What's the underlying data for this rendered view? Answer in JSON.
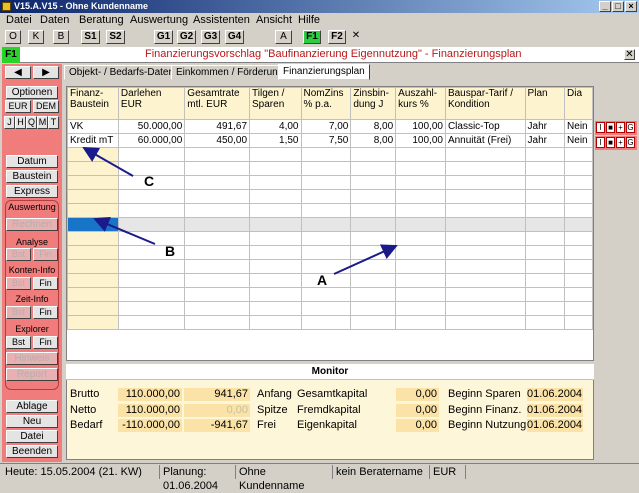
{
  "window": {
    "title": "V15.A.V15 - Ohne Kundenname"
  },
  "menu": [
    "Datei",
    "Daten",
    "Beratung",
    "Auswertung",
    "Assistenten",
    "Ansicht",
    "Hilfe"
  ],
  "toolbar": [
    "O",
    "K",
    "B",
    "S1",
    "S2",
    "G1",
    "G2",
    "G3",
    "G4",
    "A",
    "F1",
    "F2",
    "✕"
  ],
  "header": {
    "badge": "F1",
    "title": "Finanzierungsvorschlag \"Baufinanzierung Eigennutzung\" - Finanzierungsplan"
  },
  "sidebar": {
    "optionen": "Optionen",
    "eur": "EUR",
    "dem": "DEM",
    "period": [
      "J",
      "H",
      "Q",
      "M",
      "T"
    ],
    "datum": "Datum",
    "baustein": "Baustein",
    "express": "Express",
    "auswertung": "Auswertung",
    "rechnen": "Rechnen",
    "analyse": "Analyse",
    "konten": "Konten-Info",
    "zeit": "Zeit-Info",
    "explorer": "Explorer",
    "bst": "Bst",
    "fin": "Fin",
    "hinweis": "Hinweis",
    "report": "Report",
    "ablage": "Ablage",
    "neu": "Neu",
    "datei": "Datei",
    "beenden": "Beenden"
  },
  "tabs": [
    "Objekt- / Bedarfs-Daten",
    "Einkommen / Förderung",
    "Finanzierungsplan"
  ],
  "grid": {
    "headers": [
      "Finanz-Baustein",
      "Darlehen EUR",
      "Gesamtrate mtl. EUR",
      "Tilgen / Sparen",
      "NomZins % p.a.",
      "Zinsbin-dung J",
      "Auszahl-kurs %",
      "Bauspar-Tarif / Kondition",
      "Plan",
      "Dia"
    ],
    "rows": [
      [
        "VK",
        "50.000,00",
        "491,67",
        "4,00",
        "7,00",
        "8,00",
        "100,00",
        "Classic-Top",
        "Jahr",
        "Nein"
      ],
      [
        "Kredit mT",
        "60.000,00",
        "450,00",
        "1,50",
        "7,50",
        "8,00",
        "100,00",
        "Annuität  (Frei)",
        "Jahr",
        "Nein"
      ]
    ],
    "row_buttons": [
      "I",
      "■",
      "+",
      "G"
    ]
  },
  "annotations": {
    "a": "A",
    "b": "B",
    "c": "C"
  },
  "monitor": {
    "title": "Monitor",
    "rows": [
      {
        "label": "Brutto",
        "v1": "110.000,00",
        "v2": "941,67",
        "l2": "Anfang",
        "l3": "Gesamtkapital",
        "v3": "0,00",
        "l4": "Beginn Sparen",
        "v4": "01.06.2004"
      },
      {
        "label": "Netto",
        "v1": "110.000,00",
        "v2": "0,00",
        "l2": "Spitze",
        "l3": "Fremdkapital",
        "v3": "0,00",
        "l4": "Beginn Finanz.",
        "v4": "01.06.2004"
      },
      {
        "label": "Bedarf",
        "v1": "-110.000,00",
        "v2": "-941,67",
        "l2": "Frei",
        "l3": "Eigenkapital",
        "v3": "0,00",
        "l4": "Beginn Nutzung",
        "v4": "01.06.2004"
      }
    ]
  },
  "status": [
    "Heute: 15.05.2004 (21. KW)",
    "Planung: 01.06.2004",
    "Ohne Kundenname",
    "kein Beratername",
    "EUR"
  ]
}
